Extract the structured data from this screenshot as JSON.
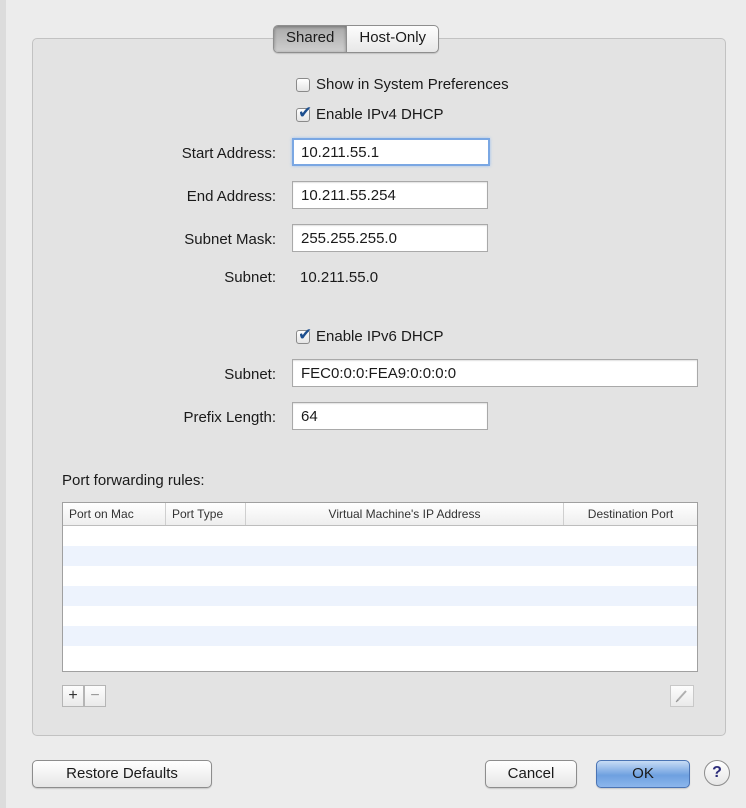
{
  "tabs": [
    {
      "label": "Shared",
      "active": true
    },
    {
      "label": "Host-Only",
      "active": false
    }
  ],
  "options": {
    "show_in_prefs": {
      "label": "Show in System Preferences",
      "checked": false
    },
    "enable_ipv4": {
      "label": "Enable IPv4 DHCP",
      "checked": true
    },
    "enable_ipv6": {
      "label": "Enable IPv6 DHCP",
      "checked": true
    }
  },
  "ipv4": {
    "start_label": "Start Address:",
    "start_value": "10.211.55.1",
    "end_label": "End Address:",
    "end_value": "10.211.55.254",
    "mask_label": "Subnet Mask:",
    "mask_value": "255.255.255.0",
    "subnet_label": "Subnet:",
    "subnet_value": "10.211.55.0"
  },
  "ipv6": {
    "subnet_label": "Subnet:",
    "subnet_value": "FEC0:0:0:FEA9:0:0:0:0",
    "prefix_label": "Prefix Length:",
    "prefix_value": "64"
  },
  "port_forwarding": {
    "title": "Port forwarding rules:",
    "columns": [
      "Port on Mac",
      "Port Type",
      "Virtual Machine's IP Address",
      "Destination Port"
    ],
    "rows": []
  },
  "controls": {
    "add_label": "+",
    "remove_label": "−",
    "check_glyph": "✔",
    "help_glyph": "?"
  },
  "footer": {
    "restore_label": "Restore Defaults",
    "cancel_label": "Cancel",
    "ok_label": "OK"
  }
}
